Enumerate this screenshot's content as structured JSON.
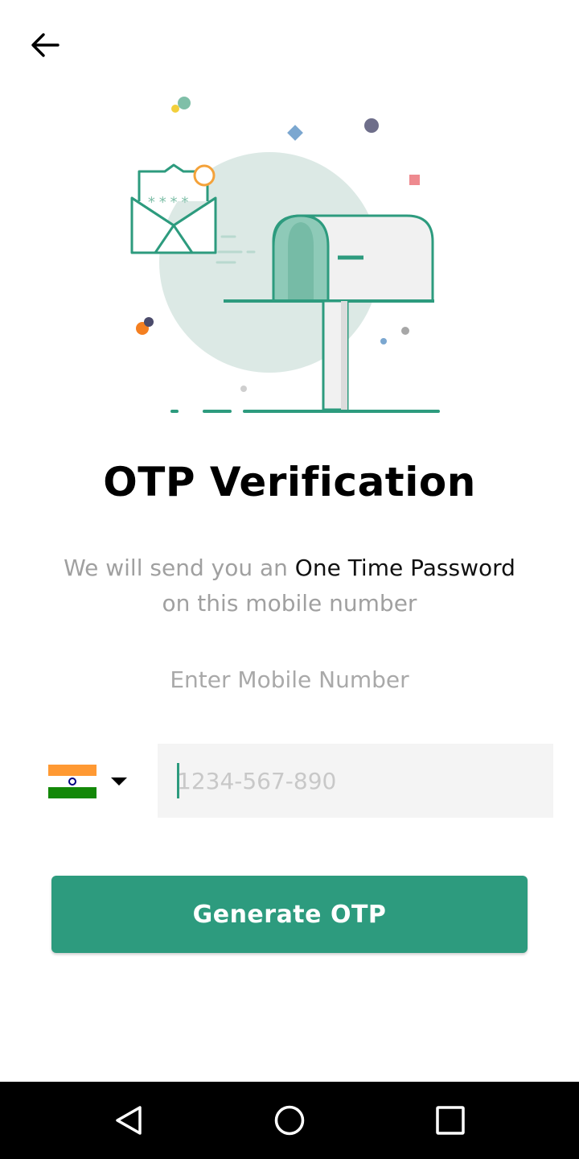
{
  "header": {
    "back_icon": "arrow-left-icon"
  },
  "illustration": {
    "envelope_code": "****",
    "icon": "mailbox-illustration"
  },
  "title": "OTP Verification",
  "subtitle": {
    "part1": "We will send you an ",
    "highlight": "One Time Password",
    "part2": "on this mobile number"
  },
  "mobile": {
    "label": "Enter Mobile Number",
    "country_flag": "india-flag-icon",
    "placeholder": "1234-567-890",
    "value": ""
  },
  "actions": {
    "generate_label": "Generate OTP"
  },
  "navbar": {
    "back": "nav-back-icon",
    "home": "nav-home-icon",
    "recents": "nav-recents-icon"
  },
  "colors": {
    "accent": "#2d9b7e",
    "muted_text": "#a0a0a0",
    "input_bg": "#f4f4f4",
    "navbar": "#000000"
  }
}
